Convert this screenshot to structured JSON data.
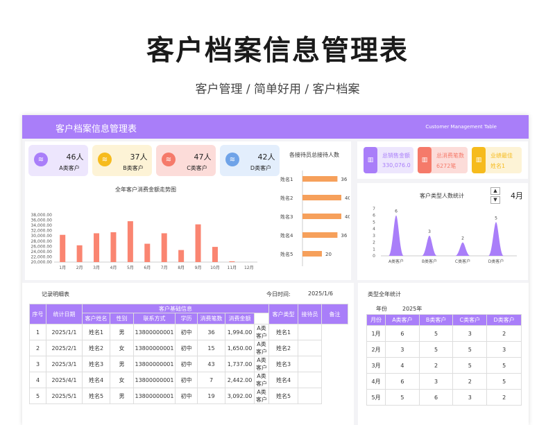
{
  "hero": {
    "title": "客户档案信息管理表",
    "subtitle": "客户管理 /  简单好用  / 客户档案"
  },
  "header": {
    "title": "客户档案信息管理表",
    "subtitle": "Customer Management Table"
  },
  "colors": {
    "accent": "#a97ef9",
    "bar": "#fa8571",
    "hbar": "#f6a05b"
  },
  "kpis": [
    {
      "count": "46人",
      "label": "A类客户",
      "icon": "db-icon",
      "bg": "#ede6fd",
      "ic": "#a97ef9"
    },
    {
      "count": "37人",
      "label": "B类客户",
      "icon": "db-icon",
      "bg": "#fdf3d6",
      "ic": "#f6bb1d"
    },
    {
      "count": "47人",
      "label": "C类客户",
      "icon": "db-icon",
      "bg": "#fcdcd9",
      "ic": "#f57a6a"
    },
    {
      "count": "42人",
      "label": "D类客户",
      "icon": "db-icon",
      "bg": "#e3eefc",
      "ic": "#6fa3e8"
    }
  ],
  "summary": [
    {
      "label": "总销售金额",
      "value": "330,076.0",
      "bg": "#ede6fd",
      "ic": "#a97ef9",
      "tc": "#a97ef9",
      "icon": "chart-icon"
    },
    {
      "label": "总消费笔数",
      "value": "6272笔",
      "bg": "#fcdcd9",
      "ic": "#f57a6a",
      "tc": "#f57a6a",
      "icon": "chart-icon"
    },
    {
      "label": "业绩最佳",
      "value": "姓名1",
      "bg": "#fdf3d6",
      "ic": "#f6bb1d",
      "tc": "#f6bb1d",
      "icon": "chart-icon"
    }
  ],
  "month_selector": {
    "value": "4月"
  },
  "chart_data": [
    {
      "type": "bar",
      "title": "全年客户消费金额走势图",
      "categories": [
        "1月",
        "2月",
        "3月",
        "4月",
        "5月",
        "6月",
        "7月",
        "8月",
        "9月",
        "10月",
        "11月",
        "12月"
      ],
      "values": [
        30400,
        26400,
        31000,
        31400,
        35600,
        27000,
        31000,
        24600,
        34400,
        25800,
        20300,
        20000
      ],
      "ylim": [
        20000,
        38000
      ],
      "yticks": [
        "20,000.00",
        "22,000.00",
        "24,000.00",
        "26,000.00",
        "28,000.00",
        "30,000.00",
        "32,000.00",
        "34,000.00",
        "36,000.00",
        "38,000.00"
      ]
    },
    {
      "type": "bar",
      "title": "各接待员总接待人数",
      "categories": [
        "姓名1",
        "姓名2",
        "姓名3",
        "姓名4",
        "姓名5"
      ],
      "values": [
        36,
        40,
        40,
        36,
        20
      ]
    },
    {
      "type": "area",
      "title": "客户类型人数统计",
      "categories": [
        "A类客户",
        "B类客户",
        "C类客户",
        "D类客户"
      ],
      "values": [
        6,
        3,
        2,
        5
      ],
      "ylim": [
        0,
        7
      ],
      "yticks": [
        "0",
        "1",
        "2",
        "3",
        "4",
        "5",
        "6",
        "7"
      ]
    }
  ],
  "records": {
    "title": "记录明细表",
    "date_label": "今日时间:",
    "date_value": "2025/1/6",
    "headers": {
      "seq": "序号",
      "date": "统计日期",
      "group": "客户基础信息",
      "name": "客户姓名",
      "gender": "性别",
      "contact": "联系方式",
      "edu": "学历",
      "count": "消费笔数",
      "amount": "消费金额",
      "type": "客户类型",
      "staff": "接待员",
      "note": "备注"
    },
    "rows": [
      [
        "1",
        "2025/1/1",
        "姓名1",
        "男",
        "13800000001",
        "初中",
        "36",
        "1,994.00",
        "A类客户",
        "姓名1",
        ""
      ],
      [
        "2",
        "2025/2/1",
        "姓名2",
        "女",
        "13800000001",
        "初中",
        "15",
        "1,650.00",
        "A类客户",
        "姓名2",
        ""
      ],
      [
        "3",
        "2025/3/1",
        "姓名3",
        "男",
        "13800000001",
        "初中",
        "43",
        "1,737.00",
        "A类客户",
        "姓名3",
        ""
      ],
      [
        "4",
        "2025/4/1",
        "姓名4",
        "女",
        "13800000001",
        "初中",
        "7",
        "2,442.00",
        "A类客户",
        "姓名4",
        ""
      ],
      [
        "5",
        "2025/5/1",
        "姓名5",
        "男",
        "13800000001",
        "初中",
        "19",
        "3,092.00",
        "A类客户",
        "姓名5",
        ""
      ]
    ]
  },
  "yearly": {
    "title": "类型全年统计",
    "year_label": "年份",
    "year_value": "2025年",
    "headers": [
      "月份",
      "A类客户",
      "B类客户",
      "C类客户",
      "D类客户"
    ],
    "rows": [
      [
        "1月",
        "6",
        "5",
        "3",
        "2"
      ],
      [
        "2月",
        "3",
        "5",
        "5",
        "3"
      ],
      [
        "3月",
        "4",
        "2",
        "5",
        "5"
      ],
      [
        "4月",
        "6",
        "3",
        "2",
        "5"
      ],
      [
        "5月",
        "5",
        "6",
        "3",
        "2"
      ]
    ]
  }
}
